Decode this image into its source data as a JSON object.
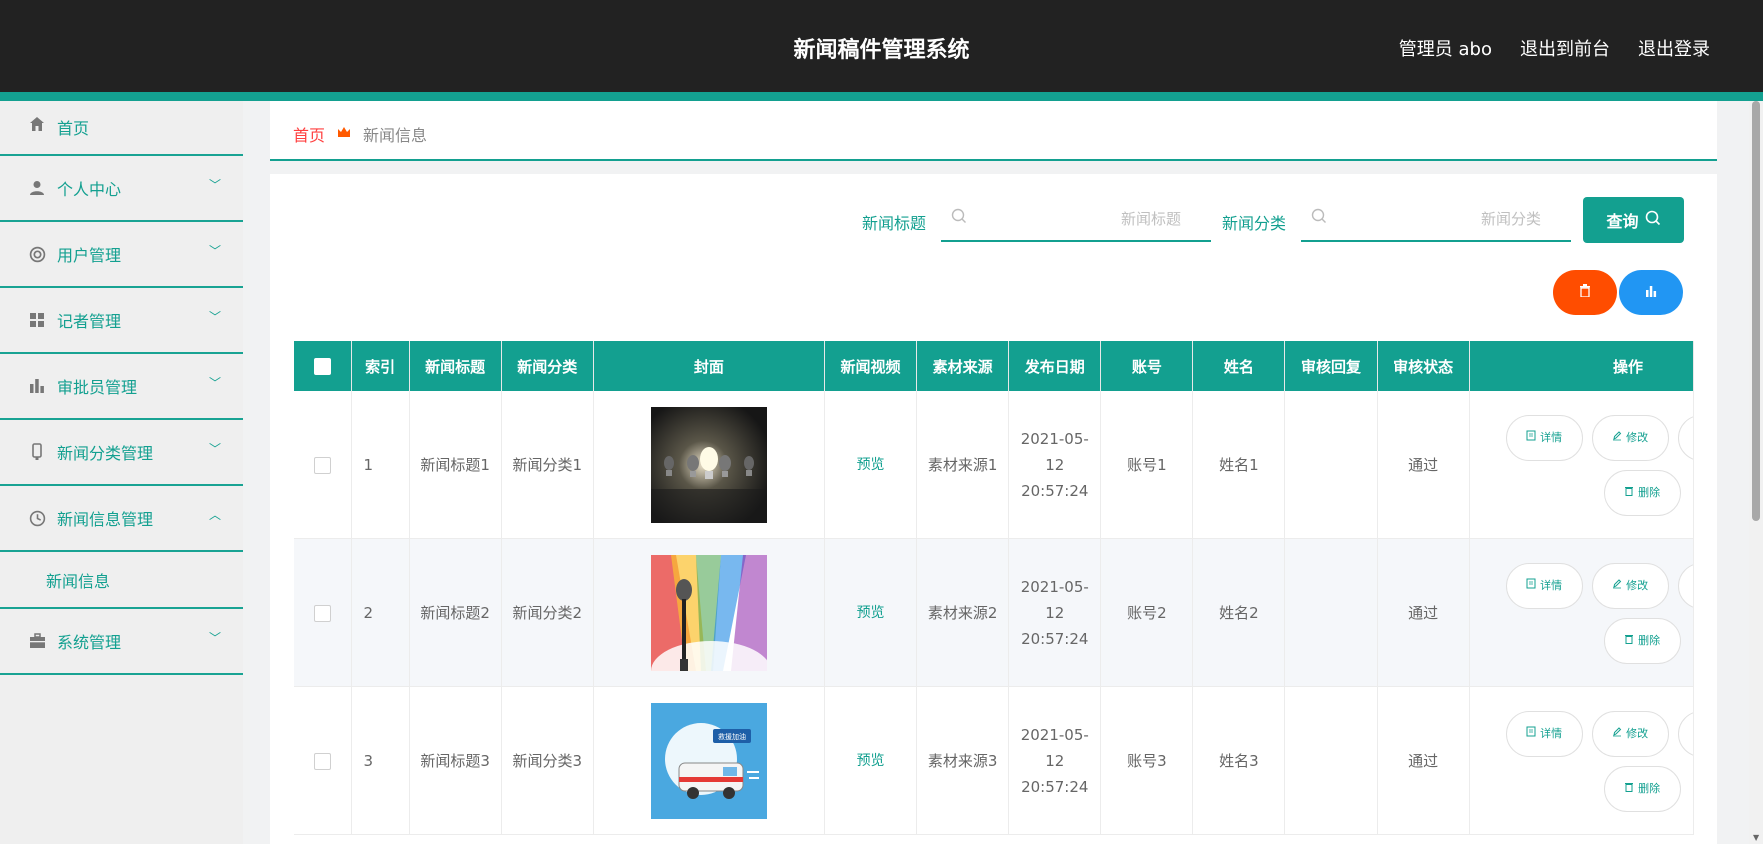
{
  "app": {
    "title": "新闻稿件管理系统",
    "admin_label": "管理员 abo",
    "to_front_label": "退出到前台",
    "logout_label": "退出登录"
  },
  "sidebar": {
    "items": [
      {
        "label": "首页",
        "icon": "home-icon"
      },
      {
        "label": "个人中心",
        "icon": "user-icon"
      },
      {
        "label": "用户管理",
        "icon": "lifebuoy-icon"
      },
      {
        "label": "记者管理",
        "icon": "grid-icon"
      },
      {
        "label": "审批员管理",
        "icon": "bar-chart-icon"
      },
      {
        "label": "新闻分类管理",
        "icon": "phone-icon"
      },
      {
        "label": "新闻信息管理",
        "icon": "clock-icon"
      },
      {
        "label": "系统管理",
        "icon": "briefcase-icon"
      }
    ],
    "submenu": {
      "label": "新闻信息"
    }
  },
  "breadcrumb": {
    "home": "首页",
    "current": "新闻信息"
  },
  "search": {
    "title_label": "新闻标题",
    "title_placeholder": "新闻标题",
    "category_label": "新闻分类",
    "category_placeholder": "新闻分类",
    "query_label": "查询"
  },
  "table": {
    "headers": [
      "索引",
      "新闻标题",
      "新闻分类",
      "封面",
      "新闻视频",
      "素材来源",
      "发布日期",
      "账号",
      "姓名",
      "审核回复",
      "审核状态",
      "操作"
    ],
    "rows": [
      {
        "index": "1",
        "title": "新闻标题1",
        "category": "新闻分类1",
        "video": "预览",
        "source": "素材来源1",
        "date": "2021-05-12 20:57:24",
        "account": "账号1",
        "name": "姓名1",
        "reply": "",
        "status": "通过"
      },
      {
        "index": "2",
        "title": "新闻标题2",
        "category": "新闻分类2",
        "video": "预览",
        "source": "素材来源2",
        "date": "2021-05-12 20:57:24",
        "account": "账号2",
        "name": "姓名2",
        "reply": "",
        "status": "通过"
      },
      {
        "index": "3",
        "title": "新闻标题3",
        "category": "新闻分类3",
        "video": "预览",
        "source": "素材来源3",
        "date": "2021-05-12 20:57:24",
        "account": "账号3",
        "name": "姓名3",
        "reply": "",
        "status": "通过"
      }
    ],
    "ops": {
      "detail": "详情",
      "edit": "修改",
      "delete": "删除"
    },
    "cover_badge": "救援加油"
  },
  "colors": {
    "accent": "#13a090",
    "topbar": "#222222",
    "danger": "#ff4d00",
    "info": "#2196f3"
  }
}
